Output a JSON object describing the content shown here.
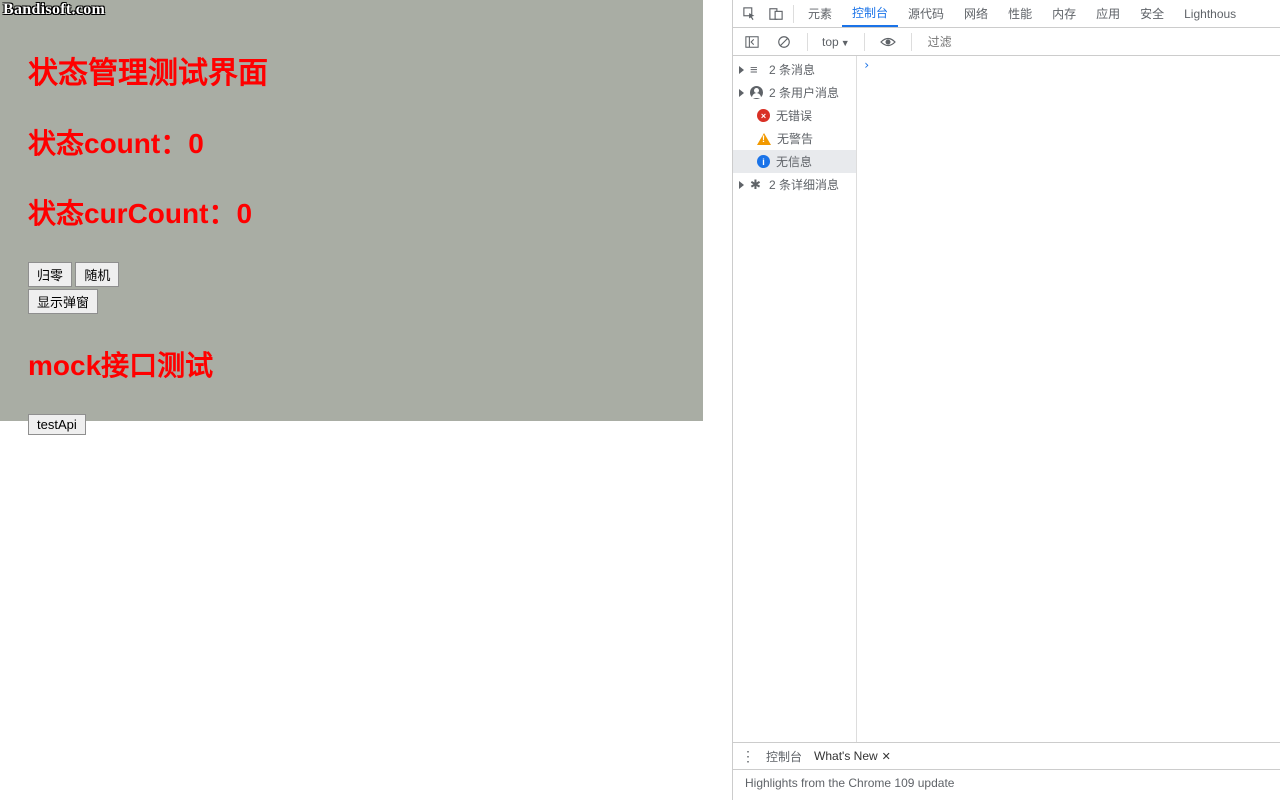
{
  "watermark": "Bandisoft.com",
  "app": {
    "title": "状态管理测试界面",
    "count_label_prefix": "状态count：",
    "count_value": "0",
    "curcount_label_prefix": "状态curCount：",
    "curcount_value": "0",
    "btn_reset": "归零",
    "btn_random": "随机",
    "btn_modal": "显示弹窗",
    "mock_title": "mock接口测试",
    "btn_testapi": "testApi"
  },
  "devtools": {
    "tabs": {
      "elements": "元素",
      "console": "控制台",
      "sources": "源代码",
      "network": "网络",
      "performance": "性能",
      "memory": "内存",
      "application": "应用",
      "security": "安全",
      "lighthouse": "Lighthous"
    },
    "toolbar": {
      "context": "top",
      "filter_placeholder": "过滤"
    },
    "sidebar": {
      "messages": "2 条消息",
      "user_messages": "2 条用户消息",
      "no_errors": "无错误",
      "no_warnings": "无警告",
      "no_info": "无信息",
      "verbose": "2 条详细消息"
    },
    "console_prompt": "›",
    "drawer": {
      "console_tab": "控制台",
      "whatsnew_tab": "What's New",
      "body": "Highlights from the Chrome 109 update"
    }
  }
}
